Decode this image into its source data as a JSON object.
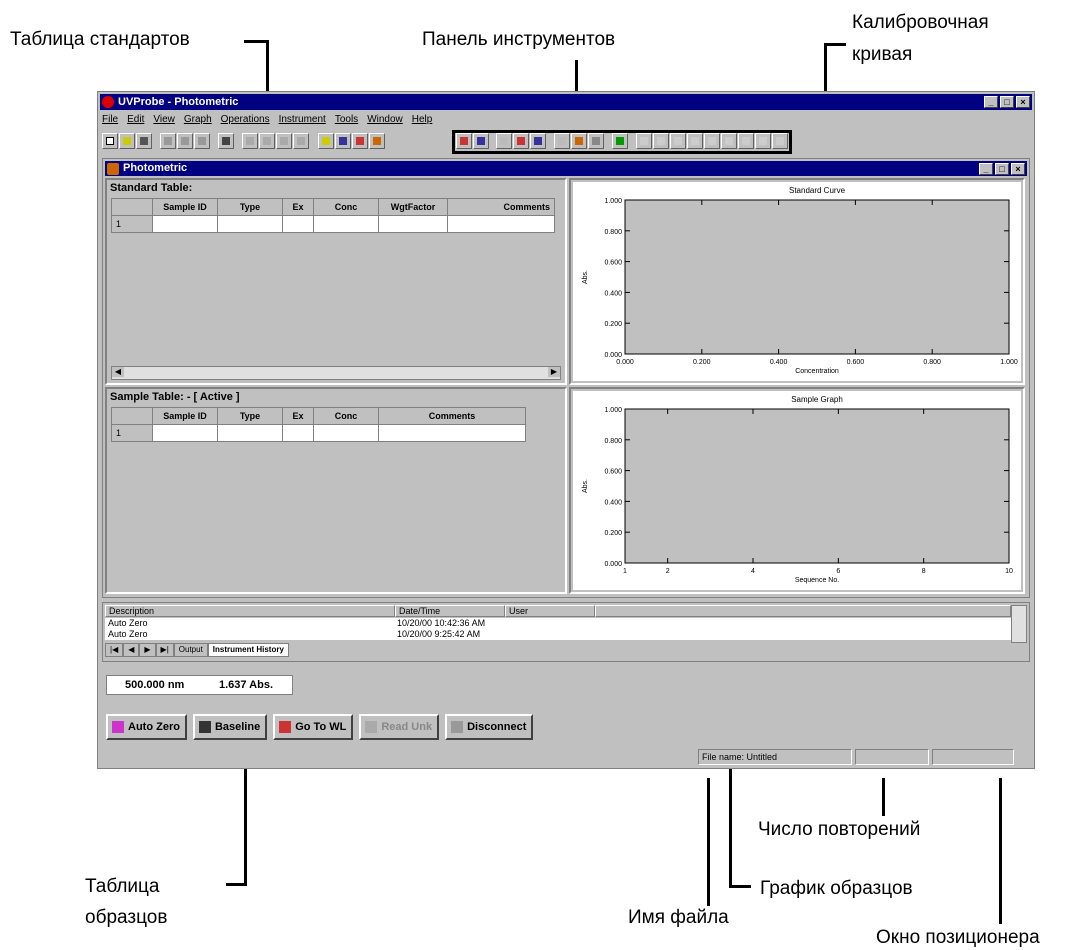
{
  "annotations": {
    "standards_table": "Таблица стандартов",
    "toolbar": "Панель инструментов",
    "calibration_curve_line1": "Калибровочная",
    "calibration_curve_line2": "кривая",
    "sample_table_line1": "Таблица",
    "sample_table_line2": "образцов",
    "sample_graph": "График образцов",
    "file_name": "Имя файла",
    "repeat_count": "Число повторений",
    "positioner_window": "Окно позиционера"
  },
  "app": {
    "title": "UVProbe - Photometric",
    "menu": [
      "File",
      "Edit",
      "View",
      "Graph",
      "Operations",
      "Instrument",
      "Tools",
      "Window",
      "Help"
    ],
    "child_title": "Photometric"
  },
  "standard_table": {
    "title": "Standard Table:",
    "columns": [
      "",
      "Sample ID",
      "Type",
      "Ex",
      "Conc",
      "WgtFactor",
      "Comments"
    ],
    "rows": [
      [
        "1",
        "",
        "",
        "",
        "",
        "",
        ""
      ]
    ]
  },
  "sample_table": {
    "title": "Sample Table: - [ Active ]",
    "columns": [
      "",
      "Sample ID",
      "Type",
      "Ex",
      "Conc",
      "Comments"
    ],
    "rows": [
      [
        "1",
        "",
        "",
        "",
        "",
        ""
      ]
    ]
  },
  "charts": {
    "standard": {
      "title": "Standard Curve",
      "xlabel": "Concentration",
      "ylabel": "Abs."
    },
    "sample": {
      "title": "Sample Graph",
      "xlabel": "Sequence No.",
      "ylabel": "Abs."
    }
  },
  "history": {
    "headers": [
      "Description",
      "Date/Time",
      "User"
    ],
    "rows": [
      [
        "Auto Zero",
        "10/20/00 10:42:36 AM",
        ""
      ],
      [
        "Auto Zero",
        "10/20/00 9:25:42 AM",
        ""
      ]
    ],
    "tabs": [
      "Output",
      "Instrument History"
    ]
  },
  "readout": {
    "wavelength": "500.000 nm",
    "abs": "1.637 Abs."
  },
  "buttons": [
    "Auto Zero",
    "Baseline",
    "Go To WL",
    "Read Unk",
    "Disconnect"
  ],
  "status": {
    "filename": "File name: Untitled",
    "repeat": "",
    "position": ""
  },
  "chart_data": [
    {
      "type": "scatter",
      "title": "Standard Curve",
      "xlabel": "Concentration",
      "ylabel": "Abs.",
      "xlim": [
        0,
        1
      ],
      "ylim": [
        0,
        1
      ],
      "xticks": [
        "0.000",
        "0.200",
        "0.400",
        "0.600",
        "0.800",
        "1.000"
      ],
      "yticks": [
        "0.000",
        "0.200",
        "0.400",
        "0.600",
        "0.800",
        "1.000"
      ],
      "series": []
    },
    {
      "type": "scatter",
      "title": "Sample Graph",
      "xlabel": "Sequence No.",
      "ylabel": "Abs.",
      "xlim": [
        1,
        10
      ],
      "ylim": [
        0,
        1
      ],
      "xticks": [
        "1",
        "2",
        "4",
        "6",
        "8",
        "10"
      ],
      "yticks": [
        "0.000",
        "0.200",
        "0.400",
        "0.600",
        "0.800",
        "1.000"
      ],
      "series": []
    }
  ]
}
